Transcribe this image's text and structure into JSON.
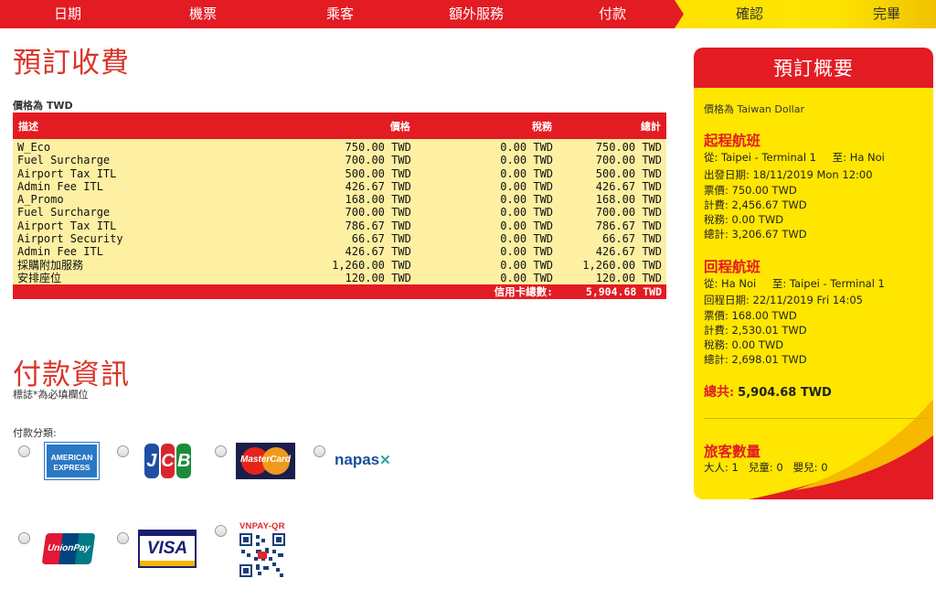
{
  "nav": {
    "steps": [
      "日期",
      "機票",
      "乘客",
      "額外服務",
      "付款",
      "確認",
      "完畢"
    ]
  },
  "booking_charges": {
    "title": "預訂收費",
    "currency_note": "價格為 TWD",
    "headers": {
      "desc": "描述",
      "price": "價格",
      "tax": "稅務",
      "total": "總計"
    },
    "rows": [
      {
        "desc": "W_Eco",
        "price": "750.00 TWD",
        "tax": "0.00 TWD",
        "total": "750.00 TWD"
      },
      {
        "desc": "Fuel Surcharge",
        "price": "700.00 TWD",
        "tax": "0.00 TWD",
        "total": "700.00 TWD"
      },
      {
        "desc": "Airport Tax ITL",
        "price": "500.00 TWD",
        "tax": "0.00 TWD",
        "total": "500.00 TWD"
      },
      {
        "desc": "Admin Fee ITL",
        "price": "426.67 TWD",
        "tax": "0.00 TWD",
        "total": "426.67 TWD"
      },
      {
        "desc": "A_Promo",
        "price": "168.00 TWD",
        "tax": "0.00 TWD",
        "total": "168.00 TWD"
      },
      {
        "desc": "Fuel Surcharge",
        "price": "700.00 TWD",
        "tax": "0.00 TWD",
        "total": "700.00 TWD"
      },
      {
        "desc": "Airport Tax ITL",
        "price": "786.67 TWD",
        "tax": "0.00 TWD",
        "total": "786.67 TWD"
      },
      {
        "desc": "Airport Security",
        "price": "66.67 TWD",
        "tax": "0.00 TWD",
        "total": "66.67 TWD"
      },
      {
        "desc": "Admin Fee ITL",
        "price": "426.67 TWD",
        "tax": "0.00 TWD",
        "total": "426.67 TWD"
      },
      {
        "desc": "採購附加服務",
        "price": "1,260.00 TWD",
        "tax": "0.00 TWD",
        "total": "1,260.00 TWD"
      },
      {
        "desc": "安排座位",
        "price": "120.00 TWD",
        "tax": "0.00 TWD",
        "total": "120.00 TWD"
      }
    ],
    "footer_label": "信用卡總數:",
    "footer_total": "5,904.68 TWD"
  },
  "payment": {
    "title": "付款資訊",
    "required_note": "標誌*為必填欄位",
    "category_label": "付款分類:",
    "methods": {
      "amex_line1": "AMERICAN",
      "amex_line2": "EXPRESS",
      "jcb": [
        "J",
        "C",
        "B"
      ],
      "jcb_colors": [
        "#1f4ea3",
        "#d7262e",
        "#1a8c3b"
      ],
      "mastercard": "MasterCard",
      "napas": "napas",
      "unionpay": "UnionPay",
      "visa": "VISA",
      "vnpay": "VNPAY-QR"
    }
  },
  "summary": {
    "title": "預訂概要",
    "currency_note": "價格為 Taiwan Dollar",
    "outbound": {
      "heading": "起程航班",
      "from_label": "從:",
      "from": "Taipei - Terminal 1",
      "to_label": "至:",
      "to": "Ha Noi",
      "date_label": "出發日期:",
      "date": "18/11/2019 Mon 12:00",
      "fare_label": "票價:",
      "fare": "750.00 TWD",
      "fees_label": "計費:",
      "fees": "2,456.67 TWD",
      "tax_label": "稅務:",
      "tax": "0.00 TWD",
      "total_label": "總計:",
      "total": "3,206.67 TWD"
    },
    "return": {
      "heading": "回程航班",
      "from_label": "從:",
      "from": "Ha Noi",
      "to_label": "至:",
      "to": "Taipei - Terminal 1",
      "date_label": "回程日期:",
      "date": "22/11/2019 Fri 14:05",
      "fare_label": "票價:",
      "fare": "168.00 TWD",
      "fees_label": "計費:",
      "fees": "2,530.01 TWD",
      "tax_label": "稅務:",
      "tax": "0.00 TWD",
      "total_label": "總計:",
      "total": "2,698.01 TWD"
    },
    "grand_total_label": "總共:",
    "grand_total": "5,904.68 TWD",
    "passengers": {
      "heading": "旅客數量",
      "adult_label": "大人:",
      "adult": "1",
      "child_label": "兒童:",
      "child": "0",
      "infant_label": "嬰兒:",
      "infant": "0"
    }
  },
  "colors": {
    "brand_red": "#e31b23",
    "brand_yellow": "#ffe600",
    "table_row": "#fdf0a3",
    "heading_red": "#d9352a"
  }
}
